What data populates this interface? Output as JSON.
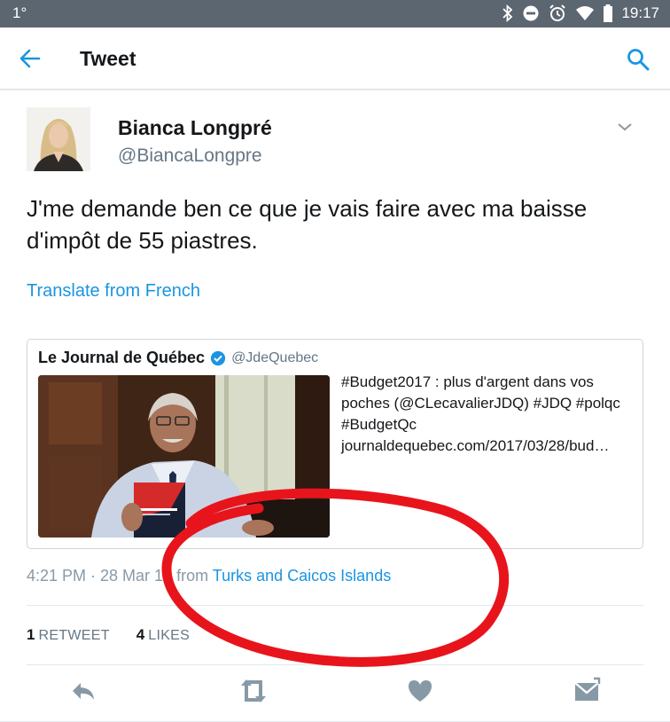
{
  "status_bar": {
    "left_text": "1°",
    "time": "19:17"
  },
  "app_bar": {
    "title": "Tweet"
  },
  "tweet": {
    "author_name": "Bianca Longpré",
    "author_handle": "@BiancaLongpre",
    "text": "J'me demande ben ce que je vais faire avec ma baisse d'impôt de 55 piastres.",
    "translate_label": "Translate from French",
    "quoted": {
      "name": "Le Journal de Québec",
      "handle": "@JdeQuebec",
      "text": "#Budget2017 : plus d'argent dans vos poches (@CLecavalierJDQ) #JDQ #polqc #BudgetQc journaldequebec.com/2017/03/28/bud…",
      "book_title": "LE PLAN ÉCONOMIQUE DU QUÉBEC"
    },
    "timestamp": "4:21 PM · 28 Mar 17",
    "from_label": "from",
    "place": "Turks and Caicos Islands",
    "retweets_count": "1",
    "retweets_label": "RETWEET",
    "likes_count": "4",
    "likes_label": "LIKES"
  },
  "colors": {
    "accent": "#1b95e0",
    "annotation": "#e8141c",
    "status_bar": "#5c6670"
  },
  "icons": [
    "back-arrow-icon",
    "search-icon",
    "chevron-down-icon",
    "verified-icon",
    "reply-icon",
    "retweet-icon",
    "like-icon",
    "direct-message-icon"
  ]
}
